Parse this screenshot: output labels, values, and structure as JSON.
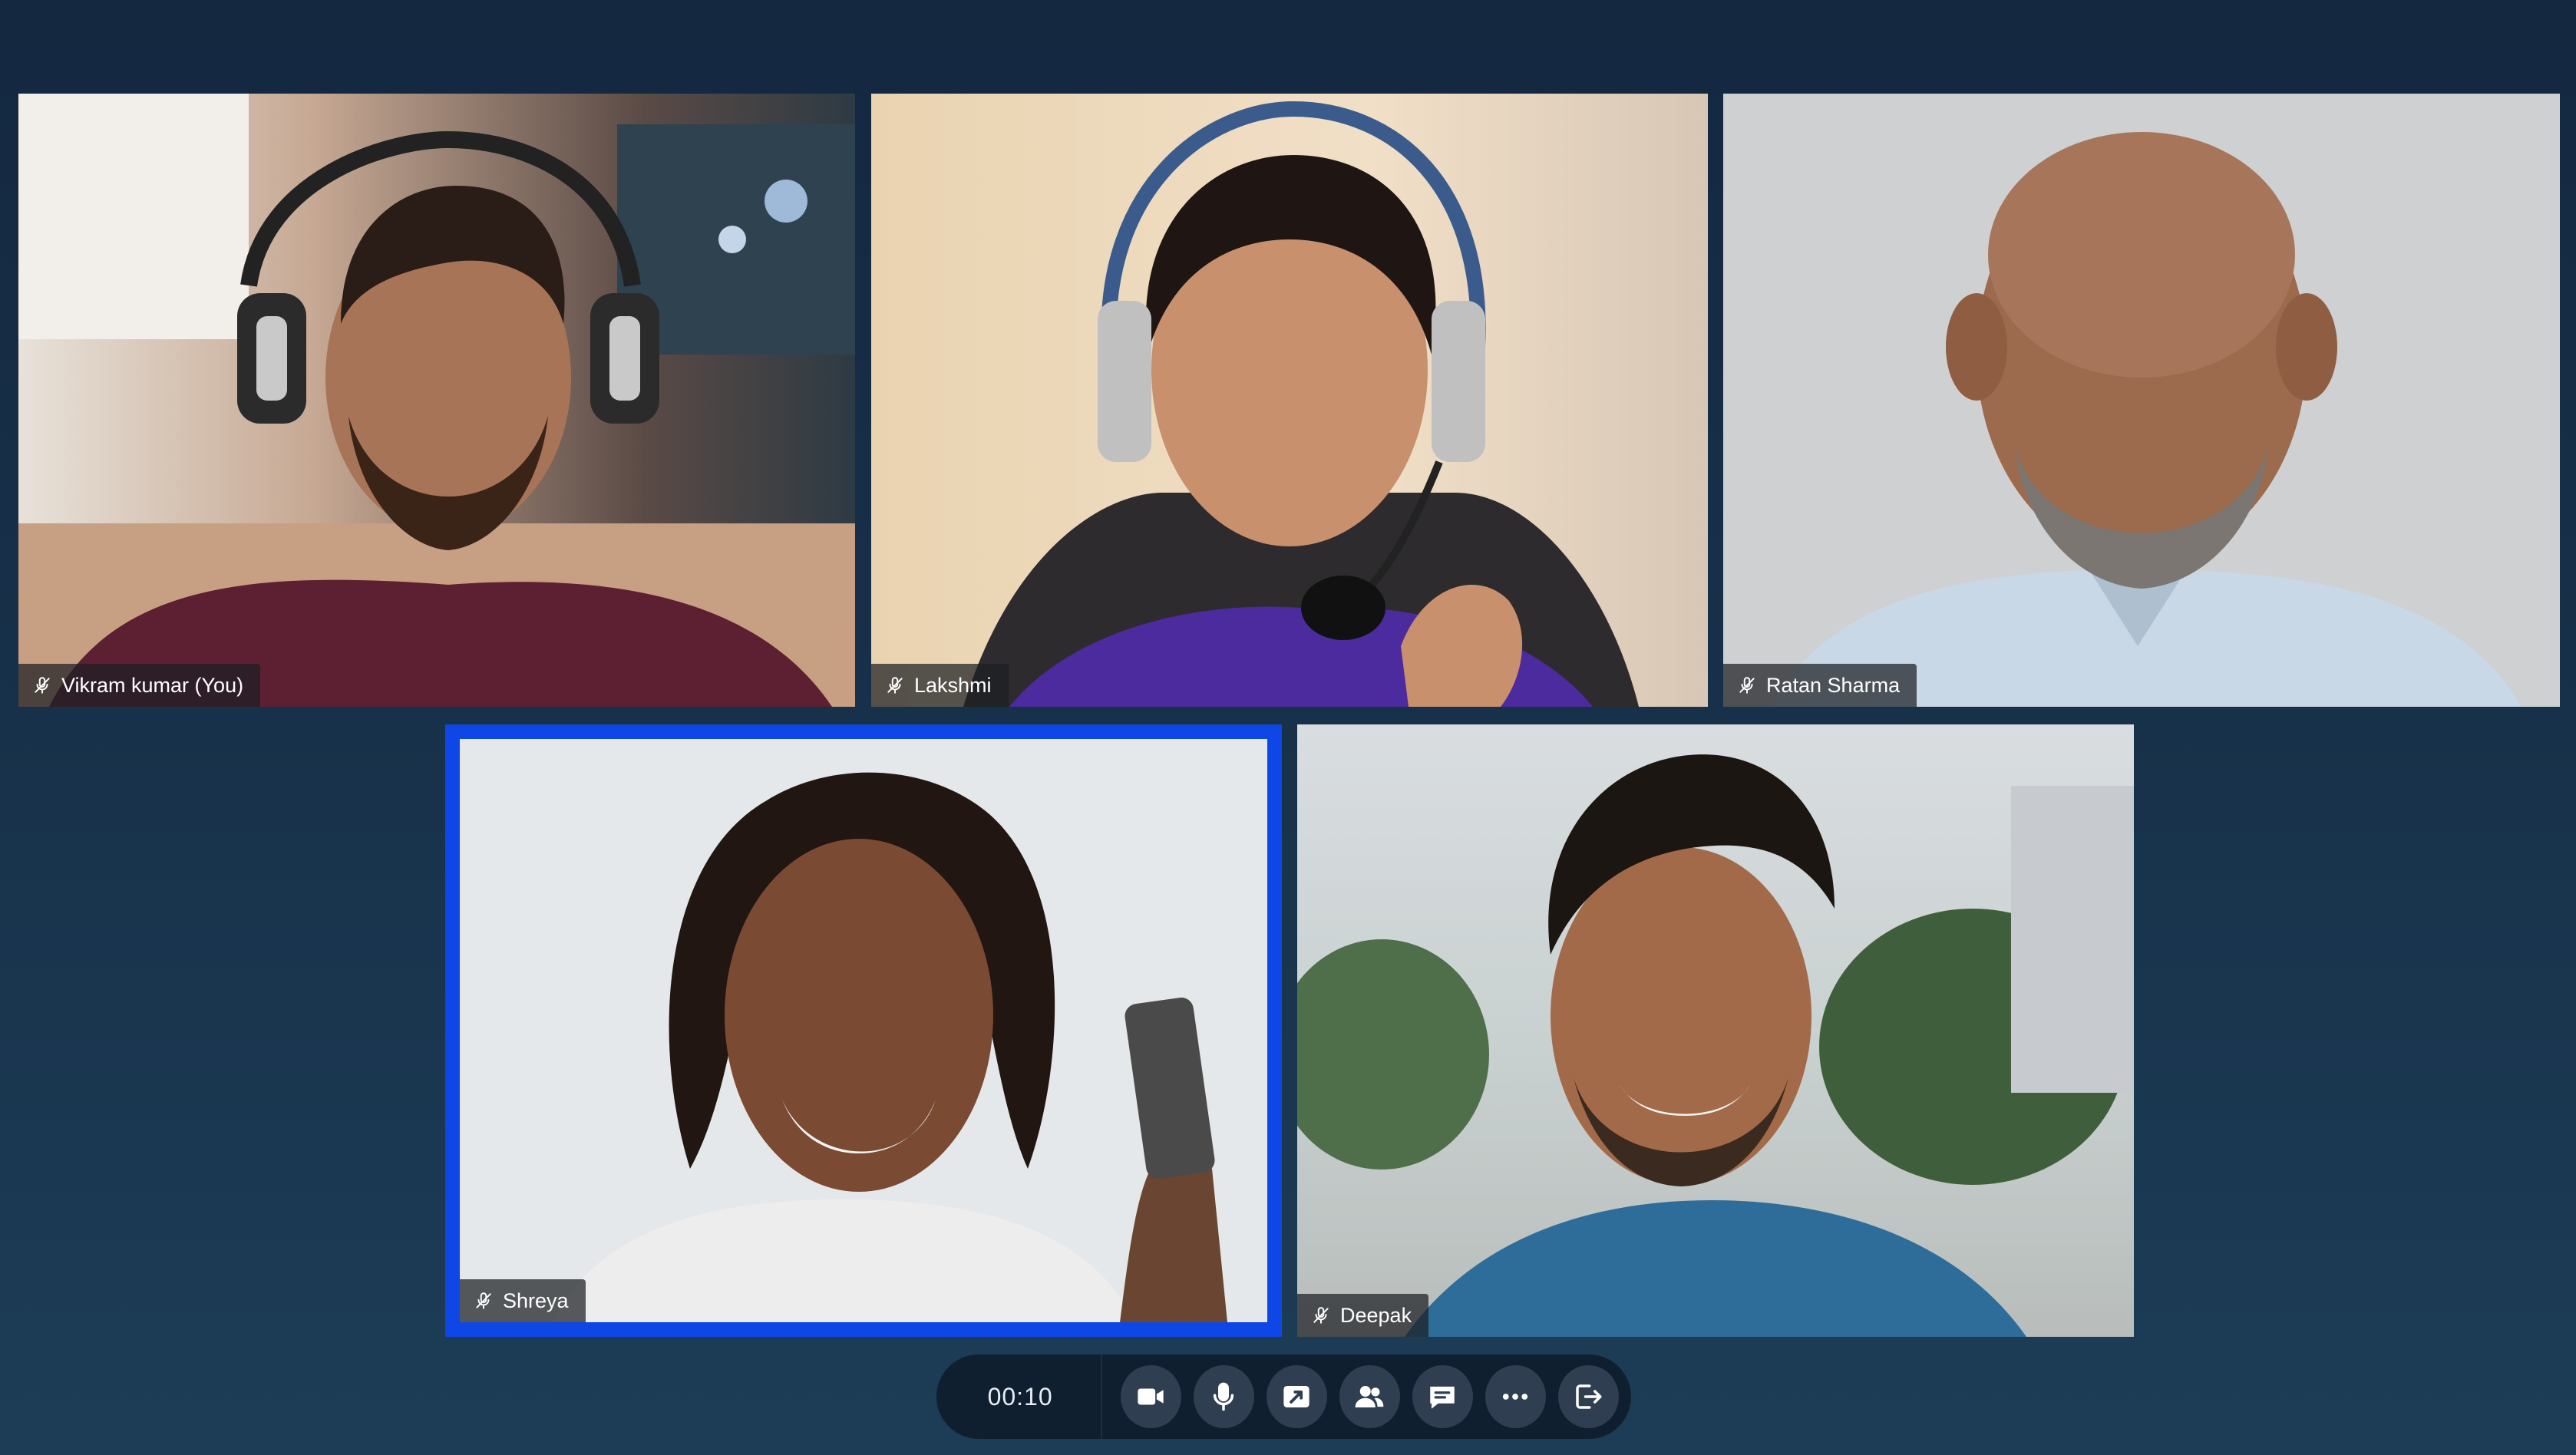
{
  "participants": [
    {
      "name": "Vikram kumar (You)",
      "muted": true
    },
    {
      "name": "Lakshmi",
      "muted": true
    },
    {
      "name": "Ratan Sharma",
      "muted": true
    },
    {
      "name": "Shreya",
      "muted": true,
      "active_speaker": true
    },
    {
      "name": "Deepak",
      "muted": true
    }
  ],
  "toolbar": {
    "timer": "00:10",
    "buttons": [
      {
        "icon": "video-camera-icon"
      },
      {
        "icon": "microphone-icon"
      },
      {
        "icon": "screen-share-icon"
      },
      {
        "icon": "participants-icon"
      },
      {
        "icon": "chat-icon"
      },
      {
        "icon": "more-options-icon"
      },
      {
        "icon": "leave-call-icon"
      }
    ]
  },
  "colors": {
    "background": "#18324b",
    "active_speaker_border": "#0f47e6",
    "toolbar": "#0f1f30",
    "toolbar_button": "#2f3e50"
  }
}
